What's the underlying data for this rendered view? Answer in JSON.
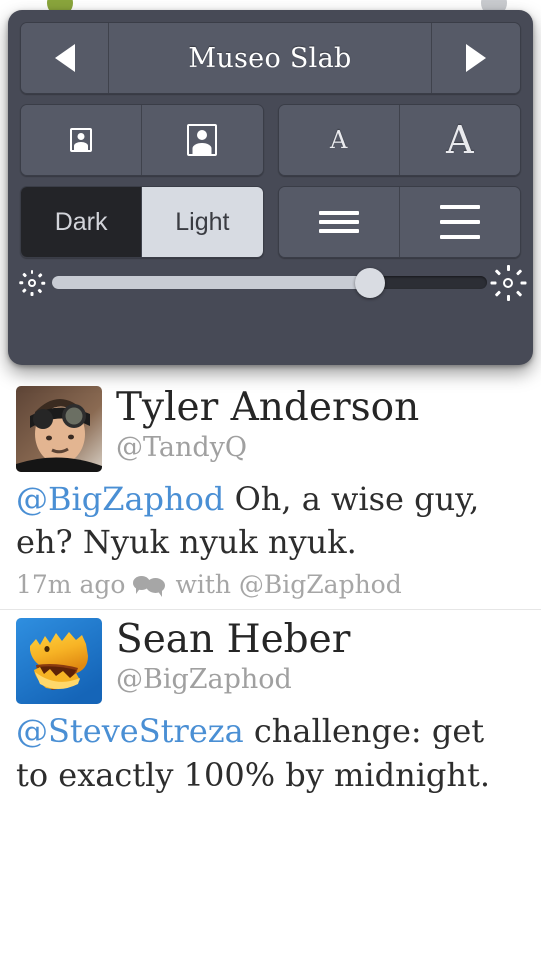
{
  "behind": {
    "left_dot_color": "#8aa53c",
    "right_dot_color": "#c9cbcf"
  },
  "popover": {
    "background_color": "#474a56",
    "font_nav": {
      "prev_icon": "triangle-left-icon",
      "next_icon": "triangle-right-icon",
      "font_name": "Museo Slab"
    },
    "avatar_size": {
      "small_icon": "avatar-small-icon",
      "large_icon": "avatar-large-icon",
      "selected": "large"
    },
    "font_size": {
      "small_label": "A",
      "large_label": "A",
      "selected": "large"
    },
    "theme": {
      "options": [
        "Dark",
        "Light"
      ],
      "selected": "Light"
    },
    "line_spacing": {
      "tight_icon": "lines-tight-icon",
      "loose_icon": "lines-loose-icon",
      "selected": "tight"
    },
    "brightness": {
      "min_icon": "sun-small-icon",
      "max_icon": "sun-large-icon",
      "value_percent": 73
    }
  },
  "timeline": {
    "tweets": [
      {
        "avatar_name": "avatar-tyler-anderson",
        "display_name": "Tyler Anderson",
        "screen_name": "@TandyQ",
        "body_mention": "@BigZaphod",
        "body_text": " Oh, a wise guy, eh? Nyuk nyuk nyuk.",
        "timestamp": "17m ago",
        "conversation_icon": "conversation-icon",
        "with_label": "with @BigZaphod"
      },
      {
        "avatar_name": "avatar-sean-heber",
        "display_name": "Sean Heber",
        "screen_name": "@BigZaphod",
        "body_mention": "@SteveStreza",
        "body_text": " challenge: get to exactly 100% by midnight.",
        "timestamp": "",
        "conversation_icon": "",
        "with_label": ""
      }
    ]
  },
  "colors": {
    "link_blue": "#4a8fd4",
    "text_dark": "#2d2d2d",
    "text_muted": "#a6a6a6",
    "popover_bg": "#474a56",
    "button_bg": "#565a67",
    "dark_segment": "#232428",
    "light_segment": "#d3d7de"
  }
}
